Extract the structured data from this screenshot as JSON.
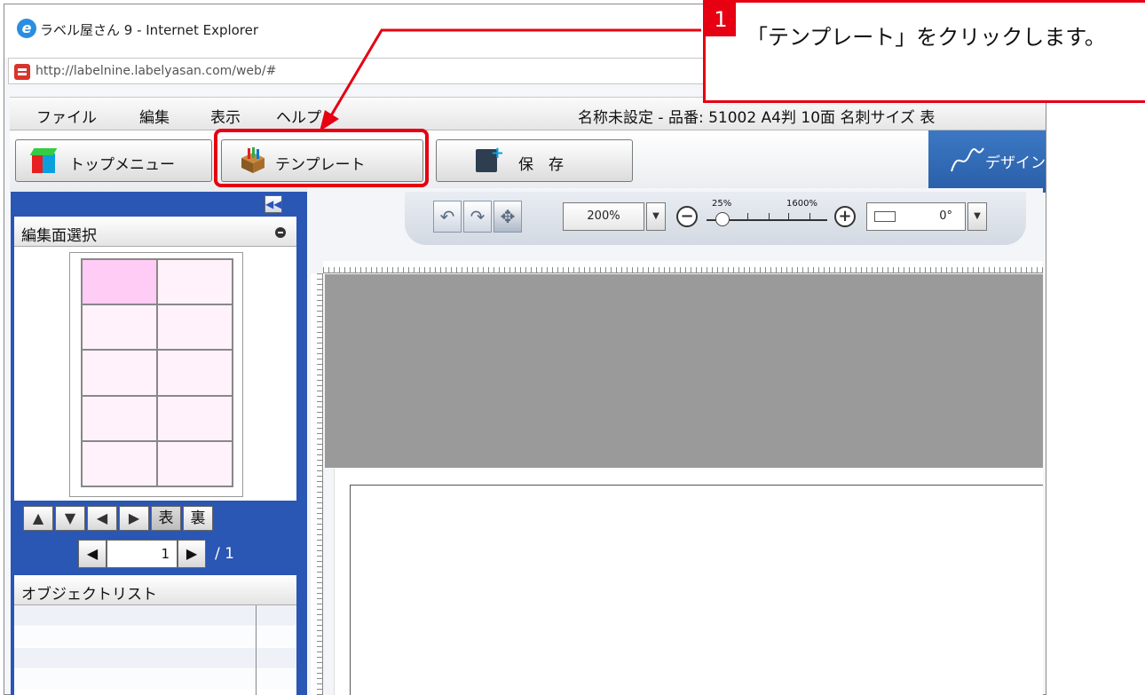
{
  "window": {
    "title": "ラベル屋さん 9 - Internet Explorer",
    "address": "http://labelnine.labelyasan.com/web/#"
  },
  "menu": {
    "items": [
      "ファイル",
      "編集",
      "表示",
      "ヘルプ"
    ],
    "doc_title": "名称未設定 - 品番: 51002 A4判 10面 名刺サイズ 表"
  },
  "toolbar": {
    "top_menu": "トップメニュー",
    "template": "テンプレート",
    "save": "保　存",
    "design": "デザイン"
  },
  "canvas_toolbar": {
    "zoom": "200%",
    "slider_min": "25%",
    "slider_max": "1600%",
    "rotation": "0°"
  },
  "left_panel": {
    "surface_title": "編集面選択",
    "front": "表",
    "back": "裏",
    "page_current": "1",
    "page_total": "/ 1",
    "object_list_title": "オブジェクトリスト"
  },
  "callout": {
    "number": "1",
    "text": "「テンプレート」をクリックします。"
  },
  "colors": {
    "accent_red": "#e60012",
    "panel_blue": "#2a56b4",
    "selected_pink": "#ffccf5"
  }
}
